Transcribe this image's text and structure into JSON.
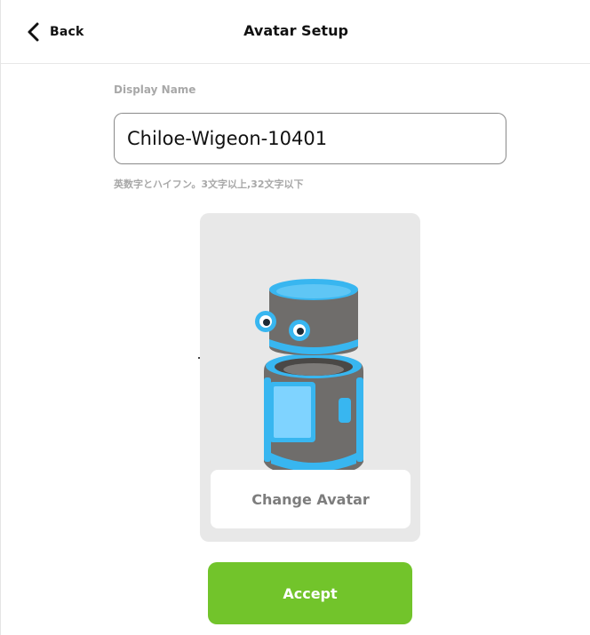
{
  "header": {
    "back_label": "Back",
    "title": "Avatar Setup"
  },
  "form": {
    "display_name_label": "Display Name",
    "display_name_value": "Chiloe-Wigeon-10401",
    "hint": "英数字とハイフン。3文字以上,32文字以下"
  },
  "avatar": {
    "change_label": "Change Avatar",
    "robot_colors": {
      "body": "#6f6d6b",
      "accent": "#38b6f0",
      "screen": "#7fd3ff"
    }
  },
  "actions": {
    "accept_label": "Accept",
    "accept_color": "#72c42b"
  },
  "icons": {
    "back": "chevron-left-icon"
  }
}
